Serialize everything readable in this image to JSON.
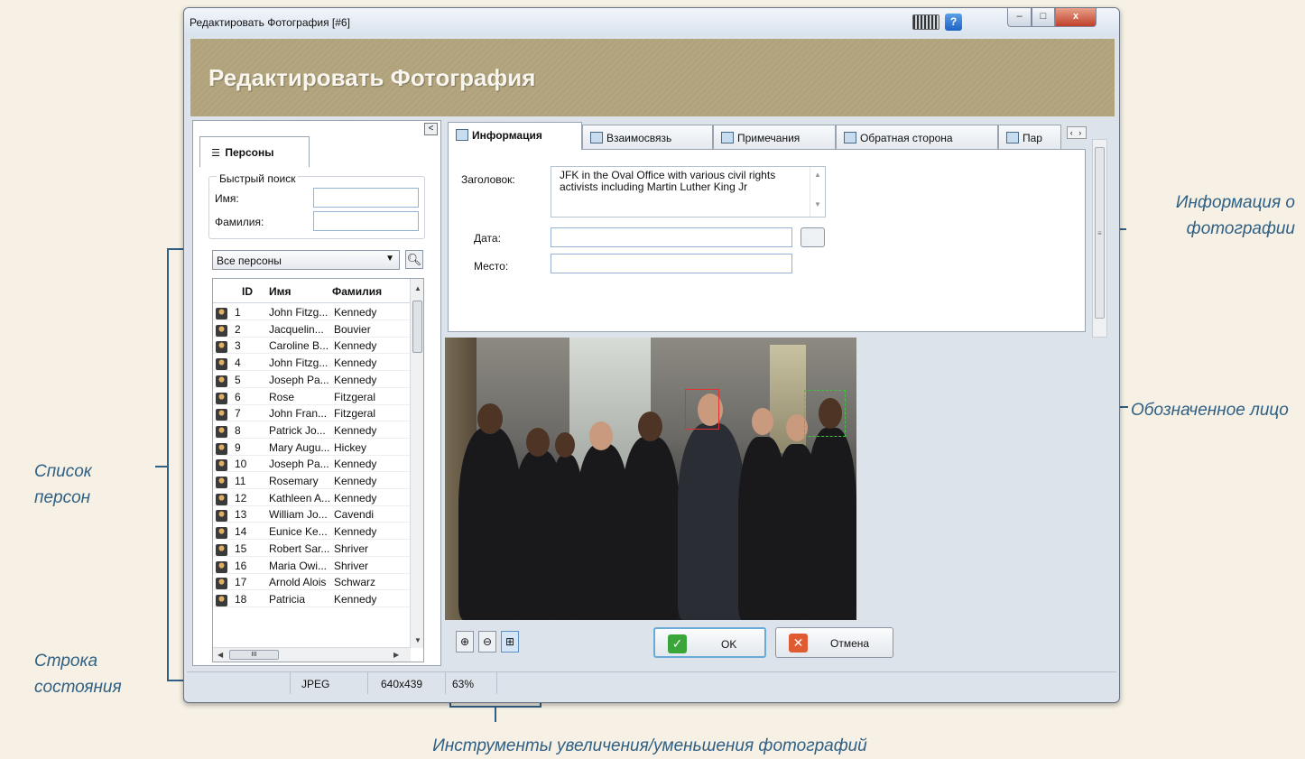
{
  "window": {
    "title": "Редактировать Фотография [#6]",
    "controls": {
      "minimize": "–",
      "maximize": "□",
      "close": "x"
    },
    "help": "?"
  },
  "banner": {
    "title": "Редактировать Фотография"
  },
  "left_panel": {
    "collapse": "<",
    "tab": "Персоны",
    "quick_search": {
      "legend": "Быстрый поиск",
      "first_name_label": "Имя:",
      "last_name_label": "Фамилия:"
    },
    "filter": "Все персоны",
    "columns": [
      "ID",
      "Имя",
      "Фамилия"
    ],
    "rows": [
      {
        "id": "1",
        "name": "John Fitzg...",
        "surname": "Kennedy"
      },
      {
        "id": "2",
        "name": "Jacquelin...",
        "surname": "Bouvier"
      },
      {
        "id": "3",
        "name": "Caroline B...",
        "surname": "Kennedy"
      },
      {
        "id": "4",
        "name": "John Fitzg...",
        "surname": "Kennedy"
      },
      {
        "id": "5",
        "name": "Joseph Pa...",
        "surname": "Kennedy"
      },
      {
        "id": "6",
        "name": "Rose",
        "surname": "Fitzgeral"
      },
      {
        "id": "7",
        "name": "John Fran...",
        "surname": "Fitzgeral"
      },
      {
        "id": "8",
        "name": "Patrick Jo...",
        "surname": "Kennedy"
      },
      {
        "id": "9",
        "name": "Mary Augu...",
        "surname": "Hickey"
      },
      {
        "id": "10",
        "name": "Joseph Pa...",
        "surname": "Kennedy"
      },
      {
        "id": "11",
        "name": "Rosemary",
        "surname": "Kennedy"
      },
      {
        "id": "12",
        "name": "Kathleen A...",
        "surname": "Kennedy"
      },
      {
        "id": "13",
        "name": "William Jo...",
        "surname": "Cavendi"
      },
      {
        "id": "14",
        "name": "Eunice Ke...",
        "surname": "Kennedy"
      },
      {
        "id": "15",
        "name": "Robert Sar...",
        "surname": "Shriver"
      },
      {
        "id": "16",
        "name": "Maria Owi...",
        "surname": "Shriver"
      },
      {
        "id": "17",
        "name": "Arnold Alois",
        "surname": "Schwarz"
      },
      {
        "id": "18",
        "name": "Patricia",
        "surname": "Kennedy"
      }
    ],
    "hscroll_grip": "III"
  },
  "tabs": [
    {
      "label": "Информация"
    },
    {
      "label": "Взаимосвязь"
    },
    {
      "label": "Примечания"
    },
    {
      "label": "Обратная сторона"
    },
    {
      "label": "Пар"
    }
  ],
  "tab_nav": "‹ ›",
  "info": {
    "title_label": "Заголовок:",
    "title_value": "JFK in the Oval Office with various civil rights activists including Martin Luther King Jr",
    "date_label": "Дата:",
    "place_label": "Место:"
  },
  "buttons": {
    "ok": "OK",
    "cancel": "Отмена",
    "info": "ⓘ"
  },
  "zoom": {
    "in": "⊕",
    "out": "⊖",
    "fit": "⊞"
  },
  "status": {
    "format": "JPEG",
    "dimensions": "640x439",
    "zoom": "63%"
  },
  "annotations": {
    "info": "Информация о фотографии",
    "face": "Обозначенное лицо",
    "persons": "Список персон",
    "status": "Строка состояния",
    "zoom": "Инструменты увеличения/уменьшения фотографий"
  }
}
